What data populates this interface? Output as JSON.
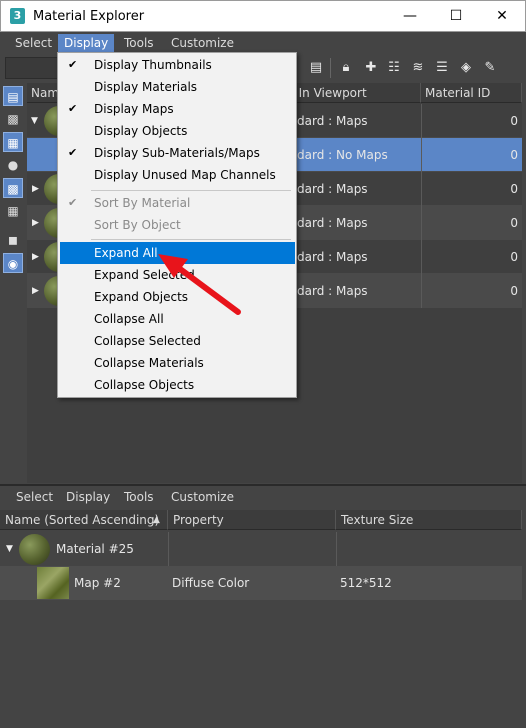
{
  "window": {
    "title": "Material Explorer",
    "app_icon": "3",
    "minimize": "—",
    "maximize": "☐",
    "close": "✕"
  },
  "menubar": {
    "items": [
      "Select",
      "Display",
      "Tools",
      "Customize"
    ]
  },
  "upper_grid": {
    "columns": [
      "Name",
      "w In Viewport",
      "Material ID"
    ],
    "rows": [
      {
        "viewport": "dard : Maps",
        "id": "0"
      },
      {
        "viewport": "dard : No Maps",
        "id": "0"
      },
      {
        "viewport": "dard : Maps",
        "id": "0"
      },
      {
        "viewport": "dard : Maps",
        "id": "0"
      },
      {
        "viewport": "dard : Maps",
        "id": "0"
      },
      {
        "viewport": "dard : Maps",
        "id": "0"
      }
    ]
  },
  "dropdown": {
    "items": [
      {
        "label": "Display Thumbnails",
        "checked": "✔"
      },
      {
        "label": "Display Materials",
        "checked": ""
      },
      {
        "label": "Display Maps",
        "checked": "✔"
      },
      {
        "label": "Display Objects",
        "checked": ""
      },
      {
        "label": "Display Sub-Materials/Maps",
        "checked": "✔"
      },
      {
        "label": "Display Unused Map Channels",
        "checked": ""
      },
      {
        "label": "Sort By Material",
        "checked": "✔"
      },
      {
        "label": "Sort By Object",
        "checked": ""
      },
      {
        "label": "Expand All",
        "checked": ""
      },
      {
        "label": "Expand Selected",
        "checked": ""
      },
      {
        "label": "Expand Objects",
        "checked": ""
      },
      {
        "label": "Collapse All",
        "checked": ""
      },
      {
        "label": "Collapse Selected",
        "checked": ""
      },
      {
        "label": "Collapse Materials",
        "checked": ""
      },
      {
        "label": "Collapse Objects",
        "checked": ""
      }
    ]
  },
  "bottom_menu": {
    "items": [
      "Select",
      "Display",
      "Tools",
      "Customize"
    ]
  },
  "lower_grid": {
    "columns": [
      "Name (Sorted Ascending)",
      "Property",
      "Texture Size"
    ],
    "sort_indicator": "▲",
    "rows": [
      {
        "name": "Material #25",
        "property": "",
        "size": ""
      },
      {
        "name": "Map #2",
        "property": "Diffuse Color",
        "size": "512*512"
      }
    ]
  },
  "colors": {
    "accent": "#5b86c7",
    "menu_highlight": "#0078d7",
    "annotation_arrow": "#e8141b"
  }
}
